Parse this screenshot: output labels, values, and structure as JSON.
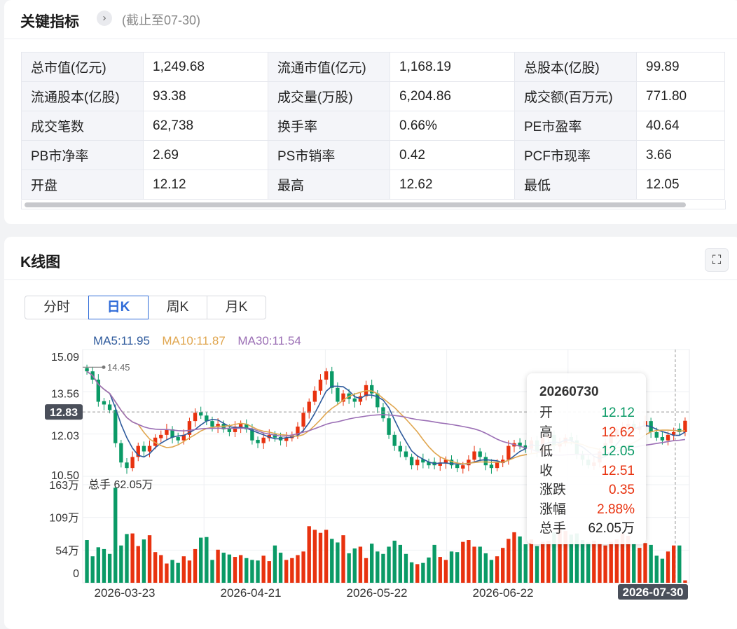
{
  "metrics": {
    "title": "关键指标",
    "as_of": "(截止至07-30)",
    "rows": [
      [
        "总市值(亿元)",
        "1,249.68",
        "流通市值(亿元)",
        "1,168.19",
        "总股本(亿股)",
        "99.89"
      ],
      [
        "流通股本(亿股)",
        "93.38",
        "成交量(万股)",
        "6,204.86",
        "成交额(百万元)",
        "771.80"
      ],
      [
        "成交笔数",
        "62,738",
        "换手率",
        "0.66%",
        "PE市盈率",
        "40.64"
      ],
      [
        "PB市净率",
        "2.69",
        "PS市销率",
        "0.42",
        "PCF市现率",
        "3.66"
      ],
      [
        "开盘",
        "12.12",
        "最高",
        "12.62",
        "最低",
        "12.05"
      ]
    ]
  },
  "kline": {
    "title": "K线图",
    "tabs": [
      {
        "label": "分时",
        "active": false
      },
      {
        "label": "日K",
        "active": true
      },
      {
        "label": "周K",
        "active": false
      },
      {
        "label": "月K",
        "active": false
      }
    ],
    "fullscreen_icon": "expand-icon",
    "tooltip": {
      "date": "20260730",
      "rows": [
        {
          "k": "开",
          "v": "12.12",
          "dir": "down"
        },
        {
          "k": "高",
          "v": "12.62",
          "dir": "up"
        },
        {
          "k": "低",
          "v": "12.05",
          "dir": "down"
        },
        {
          "k": "收",
          "v": "12.51",
          "dir": "up"
        },
        {
          "k": "涨跌",
          "v": "0.35",
          "dir": "up"
        },
        {
          "k": "涨幅",
          "v": "2.88%",
          "dir": "up"
        },
        {
          "k": "总手",
          "v": "62.05万",
          "dir": "none"
        }
      ]
    }
  },
  "chart_data": {
    "type": "candlestick",
    "ma_legend": [
      {
        "text": "MA5:11.95",
        "color": "#2e5a9c"
      },
      {
        "text": "MA10:11.87",
        "color": "#e0a64f"
      },
      {
        "text": "MA30:11.54",
        "color": "#9b6fb5"
      }
    ],
    "colors": {
      "up": "#e8320f",
      "down": "#0a9a66"
    },
    "price_ticks": [
      "15.09",
      "13.56",
      "12.03",
      "10.50"
    ],
    "price_range": [
      10.5,
      15.09
    ],
    "crosshair_price": "12.83",
    "max_label": "14.45",
    "volume_ticks": [
      "163万",
      "109万",
      "54万",
      "0"
    ],
    "volume_range": [
      0,
      163
    ],
    "volume_label": "总手 62.05万",
    "x_tick_labels": [
      "2026-03-23",
      "2026-04-21",
      "2026-05-22",
      "2026-06-22",
      "2026-07-30"
    ],
    "close": [
      14.3,
      14.0,
      13.2,
      13.1,
      12.9,
      11.7,
      11.0,
      10.8,
      11.2,
      11.6,
      11.4,
      11.6,
      11.9,
      12.0,
      12.2,
      11.9,
      11.8,
      12.0,
      12.5,
      12.8,
      12.7,
      12.5,
      12.3,
      12.4,
      12.2,
      12.1,
      12.3,
      12.4,
      12.2,
      11.8,
      11.7,
      11.9,
      12.0,
      11.9,
      11.8,
      11.9,
      12.0,
      12.3,
      12.8,
      13.2,
      13.6,
      14.0,
      14.3,
      13.7,
      13.2,
      13.5,
      13.3,
      13.2,
      13.4,
      13.8,
      13.5,
      13.0,
      12.6,
      12.0,
      11.6,
      11.4,
      11.2,
      10.9,
      11.1,
      11.0,
      10.9,
      10.9,
      11.0,
      11.1,
      10.9,
      10.8,
      10.9,
      11.1,
      11.4,
      11.2,
      10.9,
      10.8,
      11.0,
      11.1,
      11.6,
      11.7,
      11.6,
      11.5,
      11.8,
      11.4,
      11.9,
      12.0,
      11.6,
      11.7,
      11.9,
      11.8,
      11.3,
      11.1,
      10.9,
      11.0,
      11.4,
      11.7,
      12.0,
      12.2,
      12.3,
      12.4,
      12.2,
      12.3,
      12.5,
      12.1,
      11.9,
      11.8,
      12.0,
      12.1,
      12.1,
      12.51
    ],
    "up": [
      false,
      false,
      false,
      false,
      false,
      false,
      false,
      false,
      true,
      true,
      false,
      true,
      true,
      true,
      true,
      false,
      false,
      true,
      true,
      true,
      false,
      false,
      false,
      true,
      false,
      false,
      true,
      true,
      false,
      false,
      false,
      true,
      true,
      false,
      false,
      true,
      true,
      true,
      true,
      true,
      true,
      true,
      true,
      false,
      false,
      true,
      false,
      false,
      true,
      true,
      false,
      false,
      false,
      false,
      false,
      false,
      false,
      false,
      true,
      false,
      false,
      false,
      true,
      true,
      false,
      false,
      true,
      true,
      true,
      false,
      false,
      false,
      true,
      true,
      true,
      true,
      false,
      false,
      true,
      false,
      true,
      true,
      false,
      true,
      true,
      false,
      false,
      false,
      false,
      true,
      true,
      true,
      true,
      true,
      true,
      true,
      false,
      true,
      true,
      false,
      false,
      false,
      true,
      true,
      false,
      true
    ],
    "volume": [
      71,
      44,
      59,
      56,
      48,
      158,
      62,
      81,
      82,
      61,
      72,
      79,
      51,
      46,
      32,
      38,
      33,
      44,
      37,
      56,
      75,
      76,
      38,
      55,
      50,
      47,
      43,
      46,
      41,
      38,
      37,
      45,
      36,
      62,
      50,
      38,
      41,
      46,
      52,
      94,
      88,
      83,
      88,
      73,
      67,
      79,
      49,
      57,
      60,
      41,
      65,
      52,
      48,
      60,
      70,
      63,
      48,
      34,
      31,
      33,
      42,
      63,
      43,
      38,
      52,
      51,
      68,
      71,
      60,
      60,
      49,
      38,
      44,
      58,
      73,
      84,
      77,
      64,
      72,
      61,
      68,
      70,
      84,
      88,
      86,
      80,
      82,
      71,
      67,
      70,
      66,
      62,
      68,
      72,
      82,
      78,
      65,
      58,
      66,
      63,
      45,
      40,
      52,
      62,
      62,
      4
    ]
  }
}
